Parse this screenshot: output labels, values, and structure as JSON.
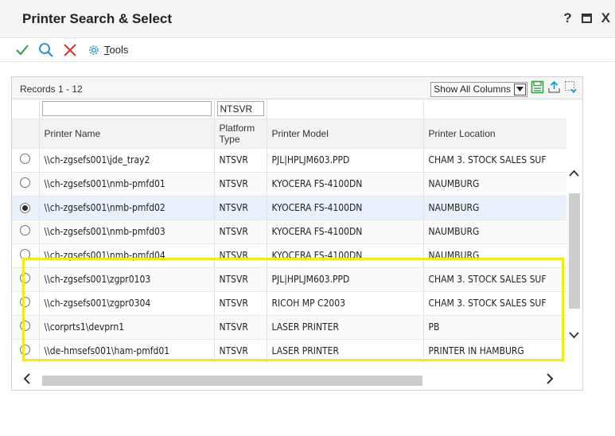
{
  "dialog": {
    "title": "Printer Search & Select",
    "help_label": "?",
    "close_label": "X"
  },
  "toolbar": {
    "select_icon": "check-icon",
    "find_icon": "search-icon",
    "cancel_icon": "close-icon",
    "tools_icon": "gear-icon",
    "tools_label_accel": "T",
    "tools_label_rest": "ools"
  },
  "grid": {
    "records_label": "Records 1 - 12",
    "columns_select": "Show All Columns",
    "qbe": {
      "printer_name": "",
      "platform_type": "NTSVR",
      "printer_model": "",
      "printer_location": ""
    },
    "columns": [
      "Printer Name",
      "Platform Type",
      "Printer Model",
      "Printer Location"
    ],
    "rows": [
      {
        "name": "\\\\ch-zgsefs001\\jde_tray2",
        "platform": "NTSVR",
        "model": "PJL|HPLJM603.PPD",
        "location": "CHAM 3. STOCK SALES SUF",
        "selected": false
      },
      {
        "name": "\\\\ch-zgsefs001\\nmb-pmfd01",
        "platform": "NTSVR",
        "model": "KYOCERA FS-4100DN",
        "location": "NAUMBURG",
        "selected": false
      },
      {
        "name": "\\\\ch-zgsefs001\\nmb-pmfd02",
        "platform": "NTSVR",
        "model": "KYOCERA FS-4100DN",
        "location": "NAUMBURG",
        "selected": true
      },
      {
        "name": "\\\\ch-zgsefs001\\nmb-pmfd03",
        "platform": "NTSVR",
        "model": "KYOCERA FS-4100DN",
        "location": "NAUMBURG",
        "selected": false
      },
      {
        "name": "\\\\ch-zgsefs001\\nmb-pmfd04",
        "platform": "NTSVR",
        "model": "KYOCERA FS-4100DN",
        "location": "NAUMBURG",
        "selected": false
      },
      {
        "name": "\\\\ch-zgsefs001\\zgpr0103",
        "platform": "NTSVR",
        "model": "PJL|HPLJM603.PPD",
        "location": "CHAM 3. STOCK SALES SUF",
        "selected": false
      },
      {
        "name": "\\\\ch-zgsefs001\\zgpr0304",
        "platform": "NTSVR",
        "model": "RICOH MP C2003",
        "location": "CHAM 3. STOCK SALES SUF",
        "selected": false
      },
      {
        "name": "\\\\corprts1\\devprn1",
        "platform": "NTSVR",
        "model": "LASER PRINTER",
        "location": "PB",
        "selected": false
      },
      {
        "name": "\\\\de-hmsefs001\\ham-pmfd01",
        "platform": "NTSVR",
        "model": "LASER PRINTER",
        "location": "PRINTER IN HAMBURG",
        "selected": false
      }
    ]
  },
  "colors": {
    "accept": "#2e9e3e",
    "find": "#1a8fd0",
    "cancel": "#d9342b",
    "highlight": "#f2ea1f"
  }
}
